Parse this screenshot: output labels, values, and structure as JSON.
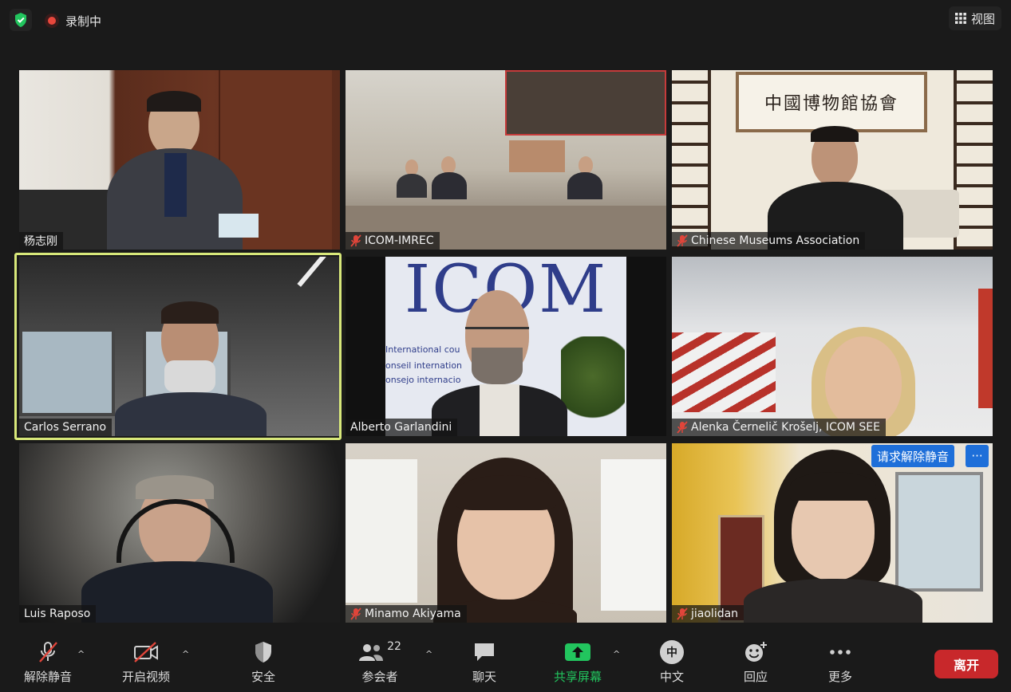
{
  "top": {
    "recording_label": "录制中",
    "view_label": "视图"
  },
  "tiles": [
    {
      "name": "杨志刚",
      "muted": false
    },
    {
      "name": "ICOM-IMREC",
      "muted": true
    },
    {
      "name": "Chinese Museums Association",
      "muted": true
    },
    {
      "name": "Carlos Serrano",
      "muted": false,
      "active_speaker": true
    },
    {
      "name": "Alberto Garlandini",
      "muted": false
    },
    {
      "name": "Alenka Černelič Krošelj, ICOM SEE",
      "muted": true
    },
    {
      "name": "Luis Raposo",
      "muted": false
    },
    {
      "name": "Minamo Akiyama",
      "muted": true
    },
    {
      "name": "jiaolidan",
      "muted": true
    }
  ],
  "tile_scene_text": {
    "wall_calligraphy": "中國博物館協會",
    "icom_logo": "ICOM",
    "icom_line1": "International cou          ms",
    "icom_line2": "onseil internation         es",
    "icom_line3": "onsejo internacio         eos"
  },
  "tile_actions": {
    "request_unmute": "请求解除静音",
    "more": "···"
  },
  "toolbar": {
    "unmute": "解除静音",
    "start_video": "开启视频",
    "security": "安全",
    "participants": "参会者",
    "participants_count": "22",
    "chat": "聊天",
    "share_screen": "共享屏幕",
    "language": "中文",
    "language_badge": "中",
    "reactions": "回应",
    "more": "更多",
    "leave": "离开"
  },
  "colors": {
    "accent_green": "#22c55e",
    "leave_red": "#c8282b",
    "active_outline": "#d8e87a",
    "request_blue": "#1e6fd9",
    "muted_red": "#e0453a"
  }
}
